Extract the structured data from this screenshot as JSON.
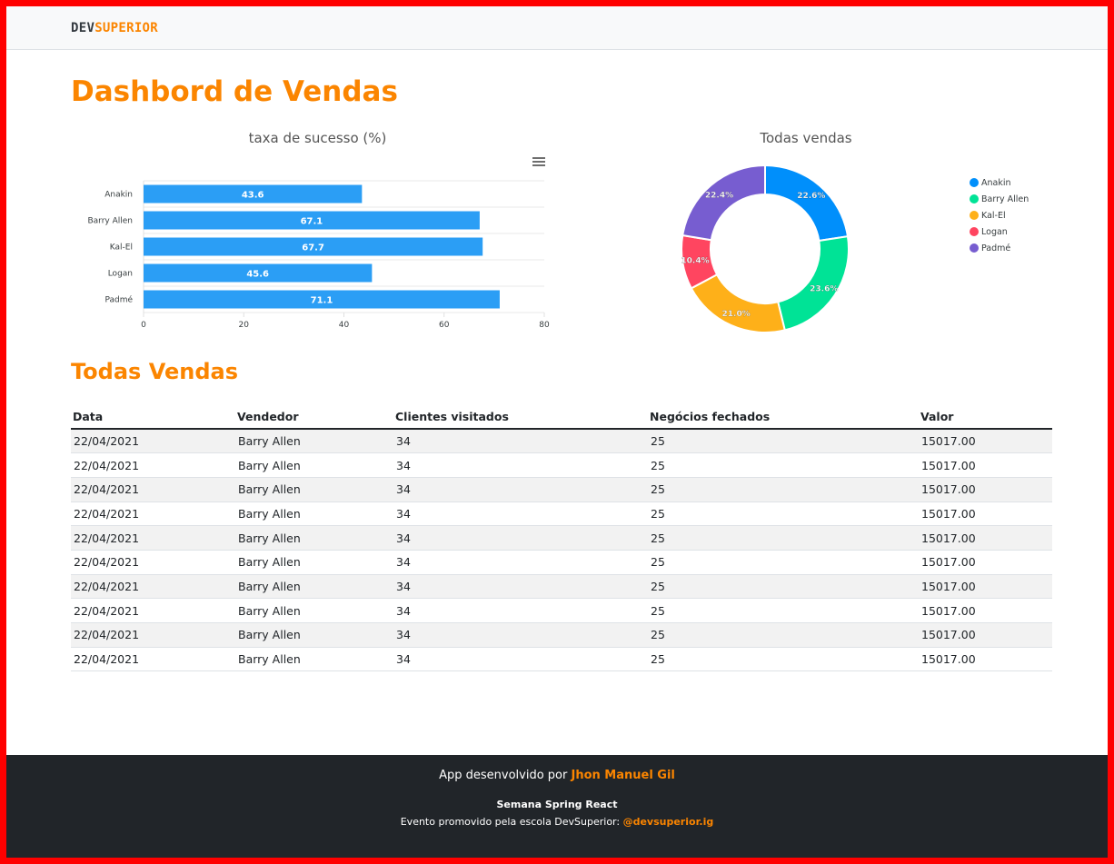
{
  "brand": {
    "dev": "DEV",
    "superior": "SUPERIOR"
  },
  "page_title": "Dashbord de Vendas",
  "section_title": "Todas Vendas",
  "colors": {
    "accent": "#fb8500",
    "bar": "#2b9ef5",
    "footer_bg": "#212529",
    "frame": "#ff0000"
  },
  "chart_data": [
    {
      "type": "bar",
      "orientation": "horizontal",
      "title": "taxa de sucesso (%)",
      "categories": [
        "Anakin",
        "Barry Allen",
        "Kal-El",
        "Logan",
        "Padmé"
      ],
      "values": [
        43.6,
        67.1,
        67.7,
        45.6,
        71.1
      ],
      "xlim": [
        0,
        80
      ],
      "xticks": [
        "0",
        "20",
        "40",
        "60",
        "80"
      ],
      "data_labels": [
        "43.6",
        "67.1",
        "67.7",
        "45.6",
        "71.1"
      ]
    },
    {
      "type": "pie",
      "donut": true,
      "title": "Todas vendas",
      "labels": [
        "Anakin",
        "Barry Allen",
        "Kal-El",
        "Logan",
        "Padmé"
      ],
      "values": [
        22.6,
        23.6,
        21.0,
        10.4,
        22.4
      ],
      "data_labels": [
        "22.6%",
        "23.6%",
        "21.0%",
        "10.4%",
        "22.4%"
      ],
      "colors": [
        "#008ffb",
        "#00e396",
        "#feb019",
        "#ff4560",
        "#775dd0"
      ],
      "legend_position": "right"
    }
  ],
  "table": {
    "headers": [
      "Data",
      "Vendedor",
      "Clientes visitados",
      "Negócios fechados",
      "Valor"
    ],
    "rows": [
      [
        "22/04/2021",
        "Barry Allen",
        "34",
        "25",
        "15017.00"
      ],
      [
        "22/04/2021",
        "Barry Allen",
        "34",
        "25",
        "15017.00"
      ],
      [
        "22/04/2021",
        "Barry Allen",
        "34",
        "25",
        "15017.00"
      ],
      [
        "22/04/2021",
        "Barry Allen",
        "34",
        "25",
        "15017.00"
      ],
      [
        "22/04/2021",
        "Barry Allen",
        "34",
        "25",
        "15017.00"
      ],
      [
        "22/04/2021",
        "Barry Allen",
        "34",
        "25",
        "15017.00"
      ],
      [
        "22/04/2021",
        "Barry Allen",
        "34",
        "25",
        "15017.00"
      ],
      [
        "22/04/2021",
        "Barry Allen",
        "34",
        "25",
        "15017.00"
      ],
      [
        "22/04/2021",
        "Barry Allen",
        "34",
        "25",
        "15017.00"
      ],
      [
        "22/04/2021",
        "Barry Allen",
        "34",
        "25",
        "15017.00"
      ]
    ]
  },
  "footer": {
    "line1_prefix": "App desenvolvido por ",
    "author": "Jhon Manuel Gil",
    "line2": "Semana Spring React",
    "line3_prefix": "Evento promovido pela escola DevSuperior: ",
    "instagram": "@devsuperior.ig"
  }
}
